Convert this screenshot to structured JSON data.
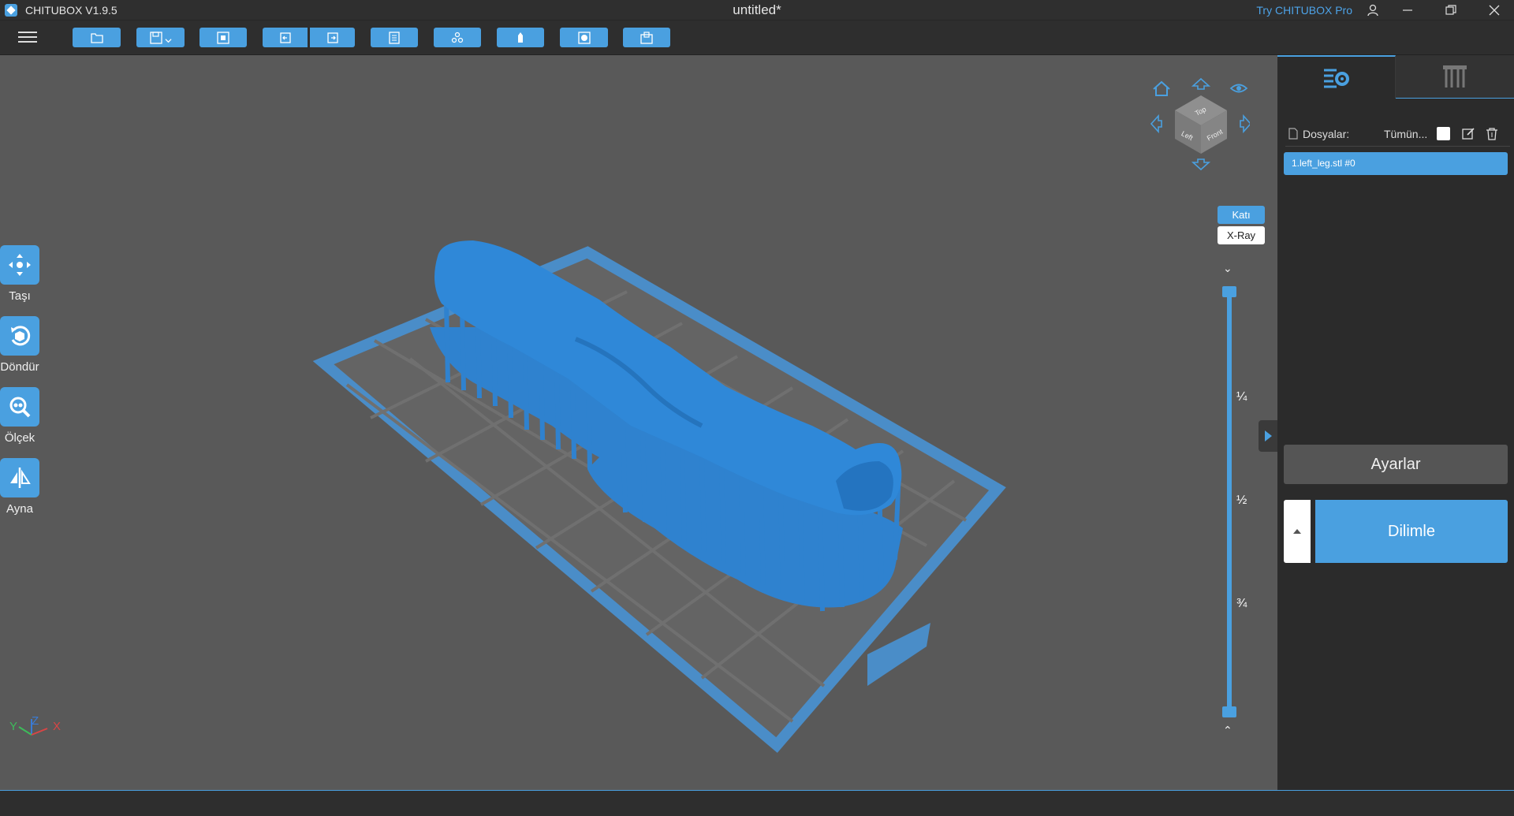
{
  "titlebar": {
    "app_name": "CHITUBOX V1.9.5",
    "document_title": "untitled*",
    "try_pro": "Try CHITUBOX Pro"
  },
  "toolbar": {
    "buttons": [
      "open-file-icon",
      "save-icon",
      "screenshot-icon",
      "undo-icon",
      "redo-icon",
      "settings-list-icon",
      "layout-icon",
      "support-icon",
      "hollow-icon",
      "drill-icon"
    ]
  },
  "left_tools": {
    "move": "Taşı",
    "rotate": "Döndür",
    "scale": "Ölçek",
    "mirror": "Ayna"
  },
  "view_cube": {
    "top": "Top",
    "left": "Left",
    "front": "Front"
  },
  "view_mode": {
    "solid": "Katı",
    "xray": "X-Ray"
  },
  "layer_slider": {
    "quarter": "¼",
    "half": "½",
    "three_quarter": "¾"
  },
  "axes": {
    "y": "Y",
    "z": "Z",
    "x": "X"
  },
  "right_panel": {
    "files_label": "Dosyalar:",
    "select_all": "Tümün...",
    "file_item": "1.left_leg.stl #0",
    "settings_button": "Ayarlar",
    "slice_button": "Dilimle"
  },
  "colors": {
    "accent": "#4aa0e0",
    "viewport": "#595959",
    "panel": "#2b2b2b"
  }
}
